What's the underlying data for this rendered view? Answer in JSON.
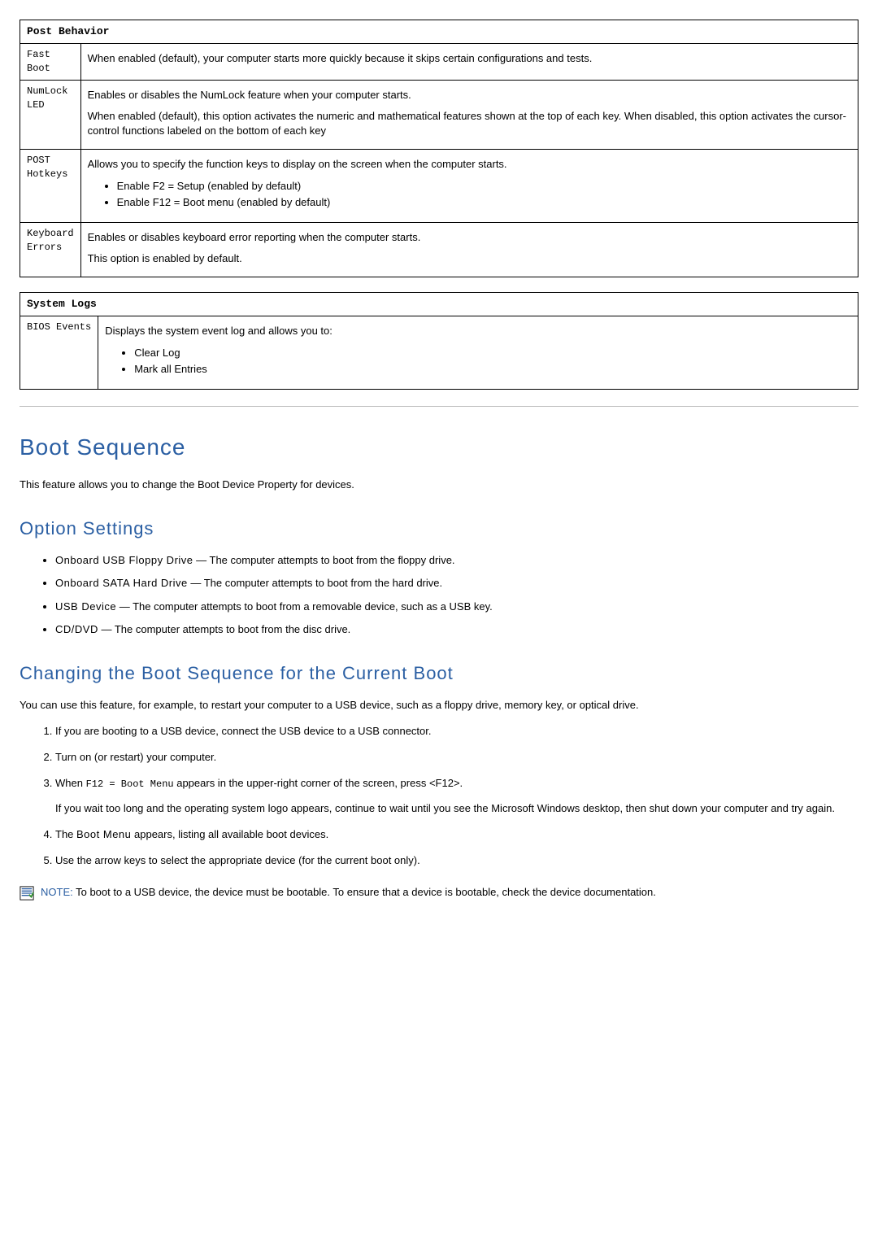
{
  "tables": {
    "post_behavior": {
      "header": "Post Behavior",
      "rows": [
        {
          "label": "Fast\nBoot",
          "p1": "When enabled (default), your computer starts more quickly because it skips certain configurations and tests."
        },
        {
          "label": "NumLock\nLED",
          "p1": "Enables or disables the NumLock feature when your computer starts.",
          "p2": "When enabled (default), this option activates the numeric and mathematical features shown at the top of each key. When disabled, this option activates the cursor-control functions labeled on the bottom of each key"
        },
        {
          "label": "POST\nHotkeys",
          "p1": "Allows you to specify the function keys to display on the screen when the computer starts.",
          "bullets": [
            "Enable F2 = Setup (enabled by default)",
            "Enable F12 = Boot menu (enabled by default)"
          ]
        },
        {
          "label": "Keyboard\nErrors",
          "p1": "Enables or disables keyboard error reporting when the computer starts.",
          "p2": "This option is enabled by default."
        }
      ]
    },
    "system_logs": {
      "header": "System Logs",
      "row": {
        "label": "BIOS Events",
        "p1": "Displays the system event log and allows you to:",
        "bullets": [
          "Clear Log",
          "Mark all Entries"
        ]
      }
    }
  },
  "headings": {
    "boot_sequence": "Boot Sequence",
    "option_settings": "Option Settings",
    "changing_boot": "Changing the Boot Sequence for the Current Boot"
  },
  "paragraphs": {
    "boot_intro": "This feature allows you to change the Boot Device Property for devices.",
    "changing_intro": "You can use this feature, for example, to restart your computer to a USB device, such as a floppy drive, memory key, or optical drive."
  },
  "option_settings": [
    {
      "name": "Onboard USB Floppy Drive",
      "desc": " — The computer attempts to boot from the floppy drive."
    },
    {
      "name": "Onboard SATA Hard Drive",
      "desc": " — The computer attempts to boot from the hard drive."
    },
    {
      "name": "USB Device",
      "desc": " — The computer attempts to boot from a removable device, such as a USB key."
    },
    {
      "name": "CD/DVD",
      "desc": " — The computer attempts to boot from the disc drive."
    }
  ],
  "steps": {
    "s1": "If you are booting to a USB device, connect the USB device to a USB connector.",
    "s2": "Turn on (or restart) your computer.",
    "s3_a": "When ",
    "s3_mono": "F12 = Boot Menu",
    "s3_b": " appears in the upper-right corner of the screen, press <F12>.",
    "s3_p": "If you wait too long and the operating system logo appears, continue to wait until you see the Microsoft Windows desktop, then shut down your computer and try again.",
    "s4_a": "The ",
    "s4_strong": "Boot Menu",
    "s4_b": " appears, listing all available boot devices.",
    "s5": "Use the arrow keys to select the appropriate device (for the current boot only)."
  },
  "note": {
    "label": "NOTE:",
    "text": " To boot to a USB device, the device must be bootable. To ensure that a device is bootable, check the device documentation."
  }
}
